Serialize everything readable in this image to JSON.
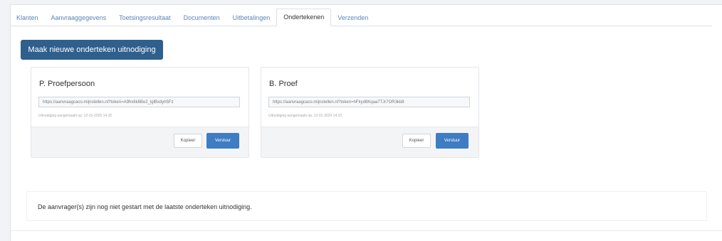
{
  "tabs": [
    {
      "label": "Klanten",
      "active": false
    },
    {
      "label": "Aanvraaggegevens",
      "active": false
    },
    {
      "label": "Toetsingsresultaat",
      "active": false
    },
    {
      "label": "Documenten",
      "active": false
    },
    {
      "label": "Uitbetalingen",
      "active": false
    },
    {
      "label": "Ondertekenen",
      "active": true
    },
    {
      "label": "Verzenden",
      "active": false
    }
  ],
  "new_invite_label": "Maak nieuwe onderteken uitnodiging",
  "signers": [
    {
      "name": "P. Proefpersoon",
      "url": "https://aanvraagcaco.mijnstellen.nl?token=A9hx8k6Be2_lglBxdyh5Fz",
      "sent": "Uitnodiging aangemaakt op: 12-01-2020 14:32",
      "copy_label": "Kopieer",
      "send_label": "Verstuur"
    },
    {
      "name": "B. Proef",
      "url": "https://aanvraagcaco.mijnstellen.nl?token=hFkyd8Kqaa7TJr7OR3kb8",
      "sent": "Uitnodiging aangemaakt op: 12-01-2020 14:32",
      "copy_label": "Kopieer",
      "send_label": "Verstuur"
    }
  ],
  "notice": "De aanvrager(s) zijn nog niet gestart met de laatste onderteken uitnodiging.",
  "colors": {
    "primary": "#2e5f8d",
    "send": "#3e7cc3",
    "tab_link": "#5a86b6"
  }
}
